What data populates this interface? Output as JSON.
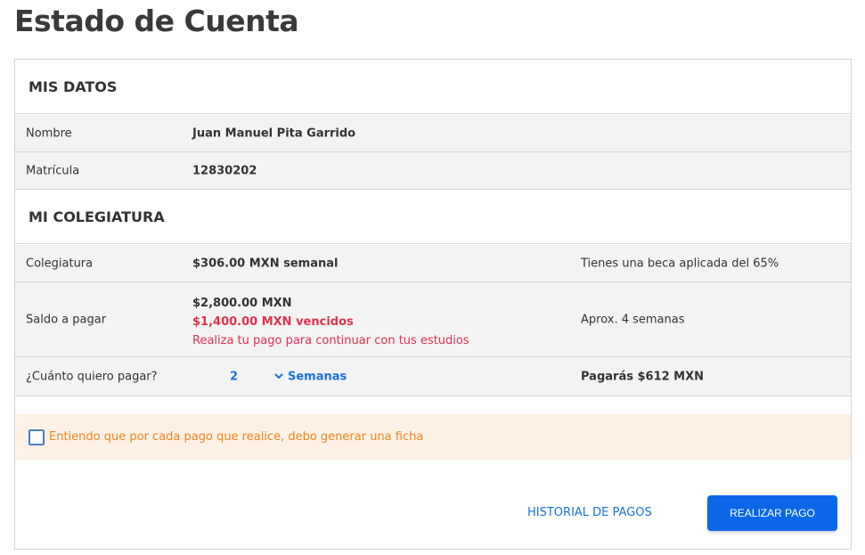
{
  "page": {
    "title": "Estado de Cuenta"
  },
  "mis_datos": {
    "heading": "MIS DATOS",
    "rows": [
      {
        "label": "Nombre",
        "value": "Juan Manuel Pita Garrido"
      },
      {
        "label": "Matrícula",
        "value": "12830202"
      }
    ]
  },
  "colegiatura": {
    "heading": "MI COLEGIATURA",
    "tuition": {
      "label": "Colegiatura",
      "value": "$306.00 MXN semanal",
      "aux": "Tienes una beca aplicada del 65%"
    },
    "balance": {
      "label": "Saldo a pagar",
      "amount": "$2,800.00 MXN",
      "overdue": "$1,400.00 MXN vencidos",
      "note": "Realiza tu pago para continuar con tus estudios",
      "aux": "Aprox. 4 semanas"
    },
    "payment": {
      "label": "¿Cuánto quiero pagar?",
      "quantity": "2",
      "period": "Semanas",
      "total": "Pagarás $612 MXN"
    }
  },
  "notice": {
    "text": "Entiendo que por cada pago que realice, debo generar una ficha",
    "checked": false
  },
  "actions": {
    "history": "HISTORIAL DE PAGOS",
    "pay": "REALIZAR PAGO"
  },
  "colors": {
    "accent": "#0a68e8",
    "link": "#1a73d9",
    "danger": "#e0334f",
    "warning": "#f0851c",
    "notice_bg": "#fdf1e6"
  },
  "icons": {
    "period_select": "chevron-down-icon",
    "notice_checkbox": "checkbox-icon"
  }
}
